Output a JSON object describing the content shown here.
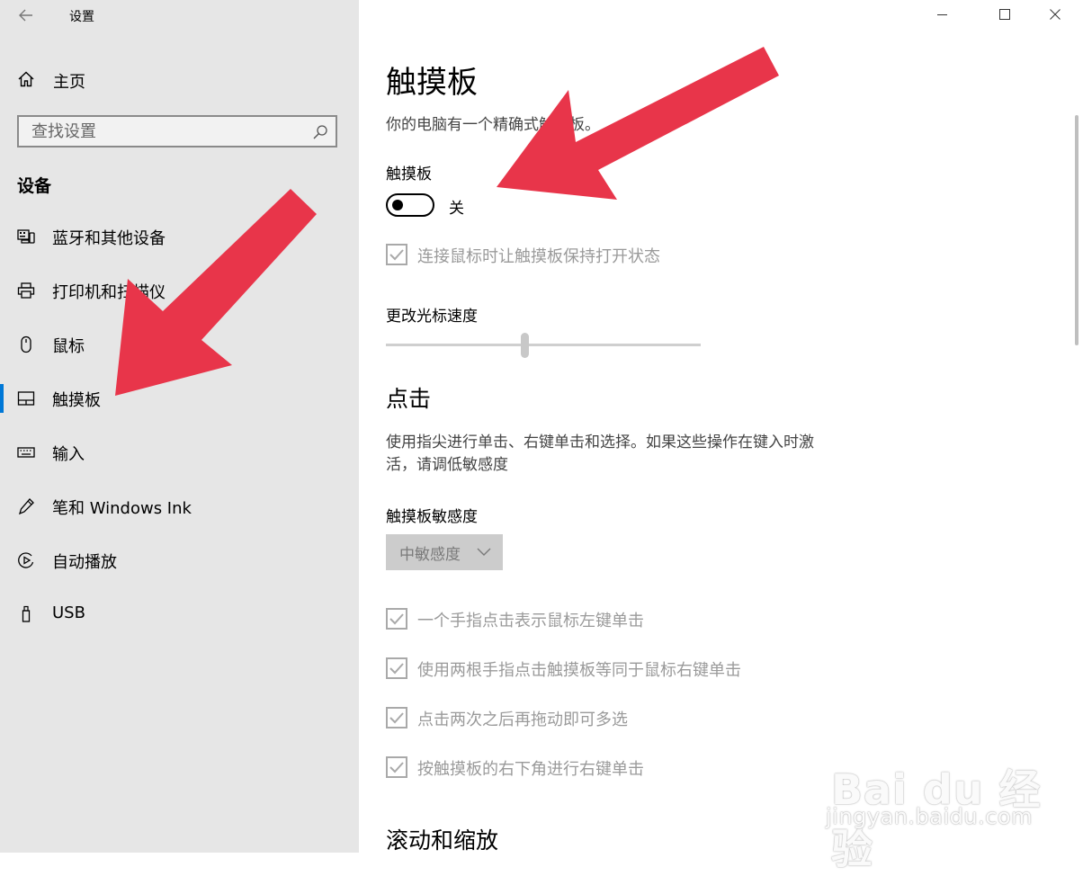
{
  "window": {
    "app_title": "设置"
  },
  "sidebar": {
    "home_label": "主页",
    "search_placeholder": "查找设置",
    "section_heading": "设备",
    "items": [
      {
        "label": "蓝牙和其他设备",
        "icon": "bluetooth-devices-icon"
      },
      {
        "label": "打印机和扫描仪",
        "icon": "printer-icon"
      },
      {
        "label": "鼠标",
        "icon": "mouse-icon"
      },
      {
        "label": "触摸板",
        "icon": "touchpad-icon",
        "selected": true
      },
      {
        "label": "输入",
        "icon": "keyboard-icon"
      },
      {
        "label": "笔和 Windows Ink",
        "icon": "pen-icon"
      },
      {
        "label": "自动播放",
        "icon": "autoplay-icon"
      },
      {
        "label": "USB",
        "icon": "usb-icon"
      }
    ]
  },
  "main": {
    "title": "触摸板",
    "description": "你的电脑有一个精确式触摸板。",
    "toggle": {
      "label": "触摸板",
      "state_label": "关",
      "on": false
    },
    "keep_on_with_mouse": "连接鼠标时让触摸板保持打开状态",
    "cursor_speed": {
      "label": "更改光标速度",
      "level": 0.44
    },
    "tap_section": {
      "heading": "点击",
      "description_line1": "使用指尖进行单击、右键单击和选择。如果这些操作在键入时激",
      "description_line2": "活，请调低敏感度",
      "sensitivity_label": "触摸板敏感度",
      "sensitivity_value": "中敏感度",
      "checkboxes": [
        "一个手指点击表示鼠标左键单击",
        "使用两根手指点击触摸板等同于鼠标右键单击",
        "点击两次之后再拖动即可多选",
        "按触摸板的右下角进行右键单击"
      ]
    },
    "scroll_section": {
      "heading": "滚动和缩放"
    }
  },
  "watermark": {
    "brand": "Bai du 经验",
    "url": "jingyan.baidu.com"
  },
  "colors": {
    "sidebar_bg": "#e6e6e6",
    "accent": "#0078d7",
    "annotation_arrow": "#e8354a"
  }
}
